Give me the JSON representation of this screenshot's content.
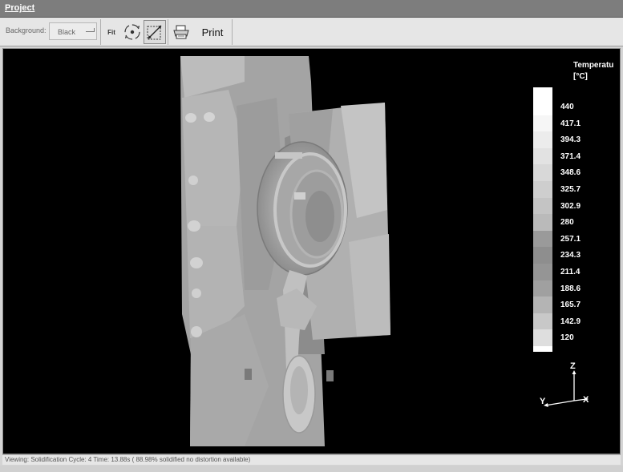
{
  "window": {
    "title": "Project"
  },
  "toolbar": {
    "background_label": "Background:",
    "background_value": "Black",
    "fit_label": "Fit",
    "print_label": "Print",
    "icons": [
      "rotate-icon",
      "zoom-window-icon",
      "printer-icon"
    ]
  },
  "legend": {
    "title": "Temperatu",
    "unit": "[°C]",
    "values": [
      "440",
      "417.1",
      "394.3",
      "371.4",
      "348.6",
      "325.7",
      "302.9",
      "280",
      "257.1",
      "234.3",
      "211.4",
      "188.6",
      "165.7",
      "142.9",
      "120"
    ]
  },
  "axes": {
    "z": "Z",
    "y": "Y",
    "x": "X"
  },
  "status": {
    "text": "Viewing: Solidification Cycle: 4   Time: 13.88s ( 88.98% solidified no distortion available)"
  },
  "colors": {
    "viewport_bg": "#000000",
    "legend_high": "#ffffff",
    "legend_low": "#808080"
  }
}
